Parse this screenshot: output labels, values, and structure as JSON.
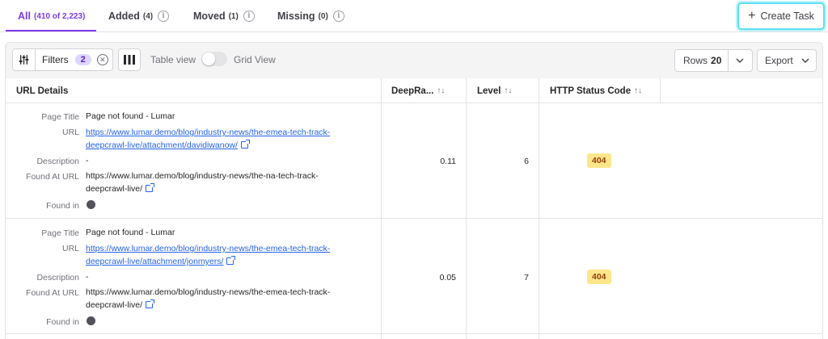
{
  "tabs": [
    {
      "label": "All",
      "count": "(410 of 2,223)",
      "active": true
    },
    {
      "label": "Added",
      "count": "(4)"
    },
    {
      "label": "Moved",
      "count": "(1)"
    },
    {
      "label": "Missing",
      "count": "(0)"
    }
  ],
  "create_task_label": "Create Task",
  "toolbar": {
    "filters_label": "Filters",
    "filters_count": "2",
    "table_view_label": "Table view",
    "grid_view_label": "Grid View",
    "rows_label": "Rows",
    "rows_value": "20",
    "export_label": "Export"
  },
  "columns": [
    "URL Details",
    "DeepRa...",
    "Level",
    "HTTP Status Code"
  ],
  "field_labels": {
    "page_title": "Page Title",
    "url": "URL",
    "description": "Description",
    "found_at_url": "Found At URL",
    "found_in": "Found in"
  },
  "rows": [
    {
      "page_title": "Page not found - Lumar",
      "url_line1": "https://www.lumar.demo/blog/industry-news/the-emea-tech-track-",
      "url_line2": "deepcrawl-live/attachment/davidiwanow/",
      "description": "-",
      "found_at_line1": "https://www.lumar.demo/blog/industry-news/the-na-tech-track-",
      "found_at_line2": "deepcrawl-live/",
      "deeprank": "0.11",
      "level": "6",
      "status": "404"
    },
    {
      "page_title": "Page not found - Lumar",
      "url_line1": "https://www.lumar.demo/blog/industry-news/the-emea-tech-track-",
      "url_line2": "deepcrawl-live/attachment/jonmyers/",
      "description": "-",
      "found_at_line1": "https://www.lumar.demo/blog/industry-news/the-emea-tech-track-",
      "found_at_line2": "deepcrawl-live/",
      "deeprank": "0.05",
      "level": "7",
      "status": "404"
    }
  ],
  "colors": {
    "accent": "#7c3aed",
    "status_bg": "#fde68a",
    "link": "#2563eb",
    "focus": "#5ee0f0"
  }
}
